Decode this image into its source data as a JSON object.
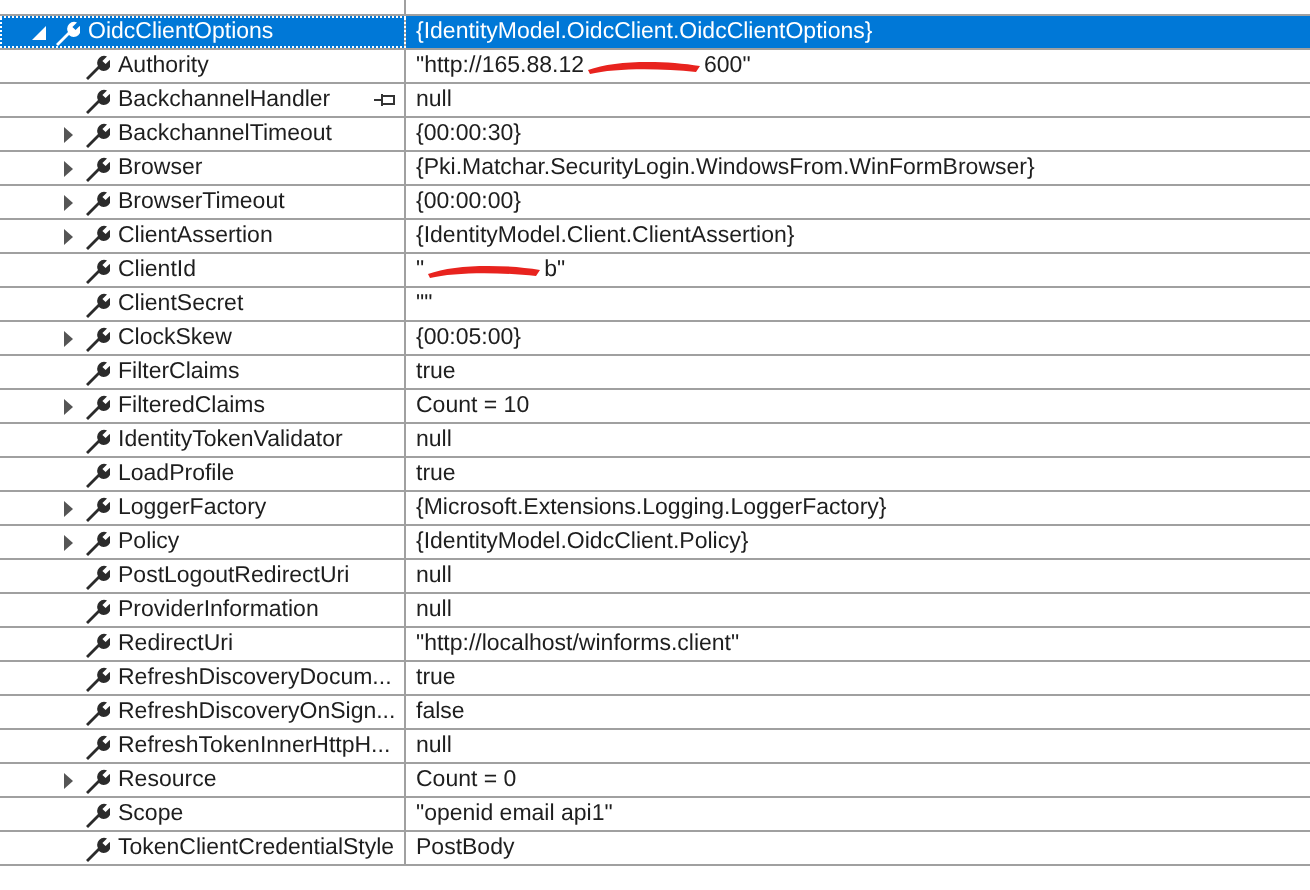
{
  "watch": {
    "name": "OidcClientOptions",
    "value": "{IdentityModel.OidcClient.OidcClientOptions}",
    "expanded": true,
    "selected": true,
    "children": [
      {
        "name": "Authority",
        "value": [
          "\"http://165.88.12",
          "600\""
        ],
        "redacted": true,
        "expandable": false,
        "pinned": false
      },
      {
        "name": "BackchannelHandler",
        "value": [
          "null"
        ],
        "redacted": false,
        "expandable": false,
        "pinned": true
      },
      {
        "name": "BackchannelTimeout",
        "value": [
          "{00:00:30}"
        ],
        "redacted": false,
        "expandable": true,
        "pinned": false
      },
      {
        "name": "Browser",
        "value": [
          "{Pki.Matchar.SecurityLogin.WindowsFrom.WinFormBrowser}"
        ],
        "redacted": false,
        "expandable": true,
        "pinned": false
      },
      {
        "name": "BrowserTimeout",
        "value": [
          "{00:00:00}"
        ],
        "redacted": false,
        "expandable": true,
        "pinned": false
      },
      {
        "name": "ClientAssertion",
        "value": [
          "{IdentityModel.Client.ClientAssertion}"
        ],
        "redacted": false,
        "expandable": true,
        "pinned": false
      },
      {
        "name": "ClientId",
        "value": [
          "\"",
          "b\""
        ],
        "redacted": true,
        "expandable": false,
        "pinned": false
      },
      {
        "name": "ClientSecret",
        "value": [
          "\"\""
        ],
        "redacted": false,
        "expandable": false,
        "pinned": false
      },
      {
        "name": "ClockSkew",
        "value": [
          "{00:05:00}"
        ],
        "redacted": false,
        "expandable": true,
        "pinned": false
      },
      {
        "name": "FilterClaims",
        "value": [
          "true"
        ],
        "redacted": false,
        "expandable": false,
        "pinned": false
      },
      {
        "name": "FilteredClaims",
        "value": [
          "Count = 10"
        ],
        "redacted": false,
        "expandable": true,
        "pinned": false
      },
      {
        "name": "IdentityTokenValidator",
        "value": [
          "null"
        ],
        "redacted": false,
        "expandable": false,
        "pinned": false
      },
      {
        "name": "LoadProfile",
        "value": [
          "true"
        ],
        "redacted": false,
        "expandable": false,
        "pinned": false
      },
      {
        "name": "LoggerFactory",
        "value": [
          "{Microsoft.Extensions.Logging.LoggerFactory}"
        ],
        "redacted": false,
        "expandable": true,
        "pinned": false
      },
      {
        "name": "Policy",
        "value": [
          "{IdentityModel.OidcClient.Policy}"
        ],
        "redacted": false,
        "expandable": true,
        "pinned": false
      },
      {
        "name": "PostLogoutRedirectUri",
        "value": [
          "null"
        ],
        "redacted": false,
        "expandable": false,
        "pinned": false
      },
      {
        "name": "ProviderInformation",
        "value": [
          "null"
        ],
        "redacted": false,
        "expandable": false,
        "pinned": false
      },
      {
        "name": "RedirectUri",
        "value": [
          "\"http://localhost/winforms.client\""
        ],
        "redacted": false,
        "expandable": false,
        "pinned": false
      },
      {
        "name": "RefreshDiscoveryDocum...",
        "value": [
          "true"
        ],
        "redacted": false,
        "expandable": false,
        "pinned": false
      },
      {
        "name": "RefreshDiscoveryOnSign...",
        "value": [
          "false"
        ],
        "redacted": false,
        "expandable": false,
        "pinned": false
      },
      {
        "name": "RefreshTokenInnerHttpH...",
        "value": [
          "null"
        ],
        "redacted": false,
        "expandable": false,
        "pinned": false
      },
      {
        "name": "Resource",
        "value": [
          "Count = 0"
        ],
        "redacted": false,
        "expandable": true,
        "pinned": false
      },
      {
        "name": "Scope",
        "value": [
          "\"openid email api1\""
        ],
        "redacted": false,
        "expandable": false,
        "pinned": false
      },
      {
        "name": "TokenClientCredentialStyle",
        "value": [
          "PostBody"
        ],
        "redacted": false,
        "expandable": false,
        "pinned": false
      }
    ]
  }
}
